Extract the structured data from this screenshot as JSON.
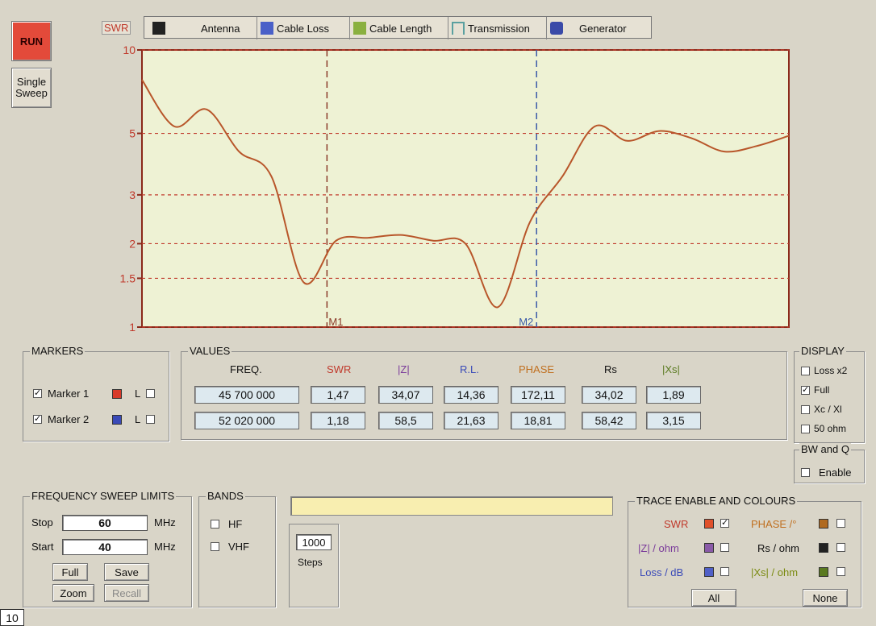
{
  "buttons": {
    "run": "RUN",
    "single": "Single\nSweep",
    "full": "Full",
    "save": "Save",
    "zoom": "Zoom",
    "recall": "Recall",
    "all": "All",
    "none": "None"
  },
  "tabs": [
    {
      "label": "Antenna",
      "icon": "antenna-icon"
    },
    {
      "label": "Cable Loss",
      "icon": "cable-loss-icon"
    },
    {
      "label": "Cable Length",
      "icon": "cable-length-icon"
    },
    {
      "label": "Transmission",
      "icon": "transmission-icon"
    },
    {
      "label": "Generator",
      "icon": "generator-icon"
    }
  ],
  "chart_data": {
    "type": "line",
    "ylabel": "SWR",
    "yscale": "log",
    "ylim": [
      1,
      10
    ],
    "yticks": [
      "10",
      "5",
      "3",
      "2",
      "1.5",
      "1"
    ],
    "grid": true,
    "series": [
      {
        "x": [
          0,
          0.05,
          0.1,
          0.15,
          0.2,
          0.25,
          0.3,
          0.35,
          0.4,
          0.45,
          0.5,
          0.55,
          0.6,
          0.65,
          0.7,
          0.75,
          0.8,
          0.85,
          0.9,
          0.95,
          1
        ],
        "y": [
          7.8,
          5.3,
          6.1,
          4.3,
          3.5,
          1.45,
          2.05,
          2.1,
          2.15,
          2.05,
          2.0,
          1.18,
          2.4,
          3.5,
          5.3,
          4.7,
          5.1,
          4.8,
          4.3,
          4.5,
          4.9
        ]
      }
    ],
    "markers": [
      {
        "label": "M1",
        "x": 0.286,
        "color": "#8b3a2a"
      },
      {
        "label": "M2",
        "x": 0.61,
        "color": "#3a5aa8"
      }
    ]
  },
  "markers_group": {
    "title": "MARKERS",
    "m1": "Marker 1",
    "m2": "Marker 2",
    "l": "L"
  },
  "values": {
    "title": "VALUES",
    "headers": [
      "FREQ.",
      "SWR",
      "|Z|",
      "R.L.",
      "PHASE",
      "Rs",
      "|Xs|"
    ],
    "row1": [
      "45 700 000",
      "1,47",
      "34,07",
      "14,36",
      "172,11",
      "34,02",
      "1,89"
    ],
    "row2": [
      "52 020 000",
      "1,18",
      "58,5",
      "21,63",
      "18,81",
      "58,42",
      "3,15"
    ]
  },
  "display": {
    "title": "DISPLAY",
    "items": [
      "Loss x2",
      "Full",
      "Xc / Xl",
      "50 ohm"
    ]
  },
  "bw": {
    "title": "BW and Q",
    "enable": "Enable"
  },
  "sweep": {
    "title": "FREQUENCY SWEEP LIMITS",
    "stop_label": "Stop",
    "stop": "60",
    "start_label": "Start",
    "start": "40",
    "unit": "MHz"
  },
  "bands": {
    "title": "BANDS",
    "hf": "HF",
    "vhf": "VHF"
  },
  "steps": {
    "value": "1000",
    "label": "Steps"
  },
  "trace": {
    "title": "TRACE ENABLE AND COLOURS",
    "swr": "SWR",
    "z": "|Z| / ohm",
    "loss": "Loss / dB",
    "phase": "PHASE /°",
    "rs": "Rs / ohm",
    "xs": "|Xs| / ohm"
  },
  "figure_number": "10"
}
